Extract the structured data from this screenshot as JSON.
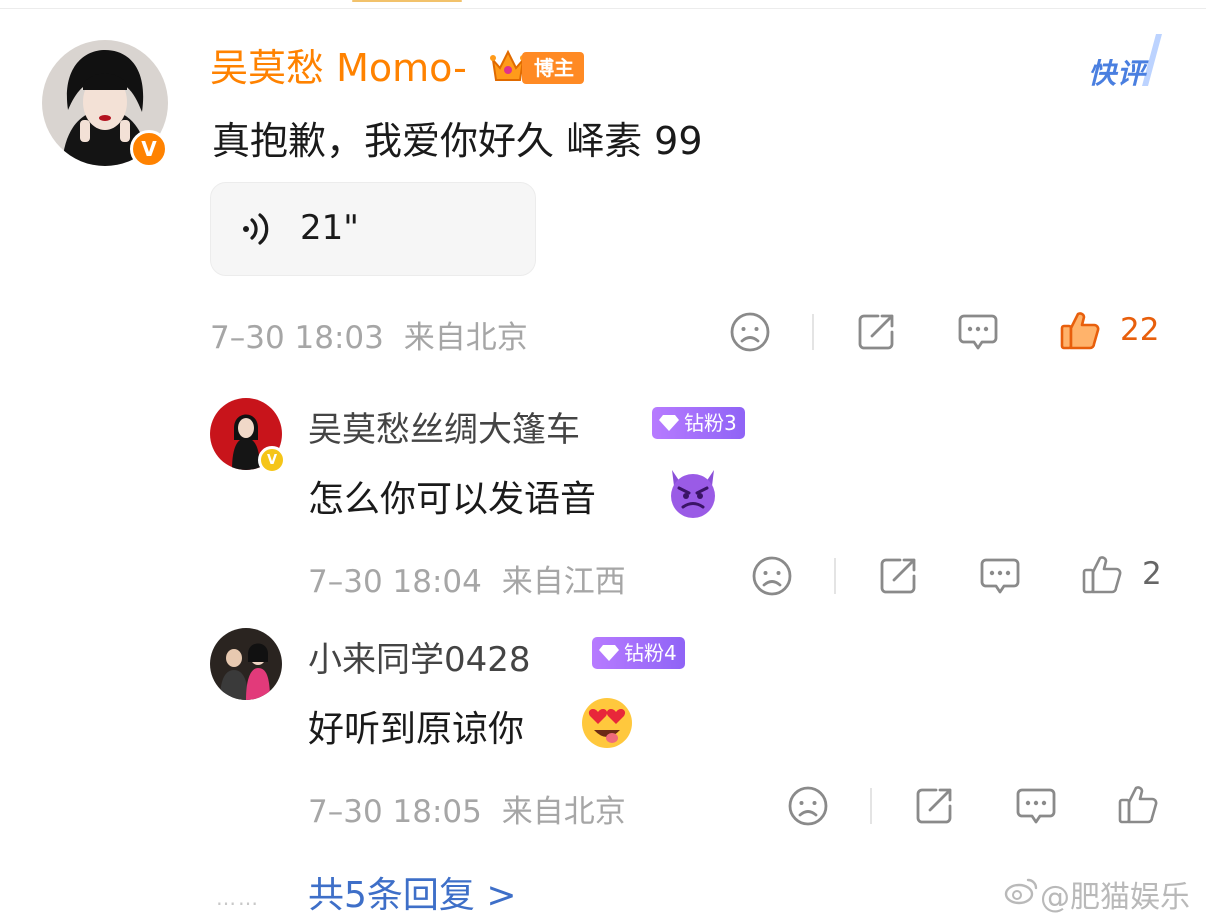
{
  "main_comment": {
    "author": "吴莫愁 Momo-",
    "owner_tag": "博主",
    "quick_label": "快评",
    "text": "真抱歉，我爱你好久 峄素 99",
    "voice_duration": "21\"",
    "timestamp": "7–30 18:03",
    "location": "来自北京",
    "like_count": "22"
  },
  "replies": [
    {
      "author": "吴莫愁丝绸大篷车",
      "fan_badge": "钻粉3",
      "text": "怎么你可以发语音",
      "emoji": "😈",
      "timestamp": "7–30 18:04",
      "location": "来自江西",
      "like_count": "2"
    },
    {
      "author": "小来同学0428",
      "fan_badge": "钻粉4",
      "text": "好听到原谅你",
      "emoji": "😍",
      "timestamp": "7–30 18:05",
      "location": "来自北京",
      "like_count": ""
    }
  ],
  "more": {
    "dots": "……",
    "label": "共5条回复 >"
  },
  "watermark": "@肥猫娱乐",
  "colors": {
    "accent_orange": "#ff8200",
    "link_blue": "#3e6fc8",
    "fan_purple": "#9b6cf8"
  }
}
